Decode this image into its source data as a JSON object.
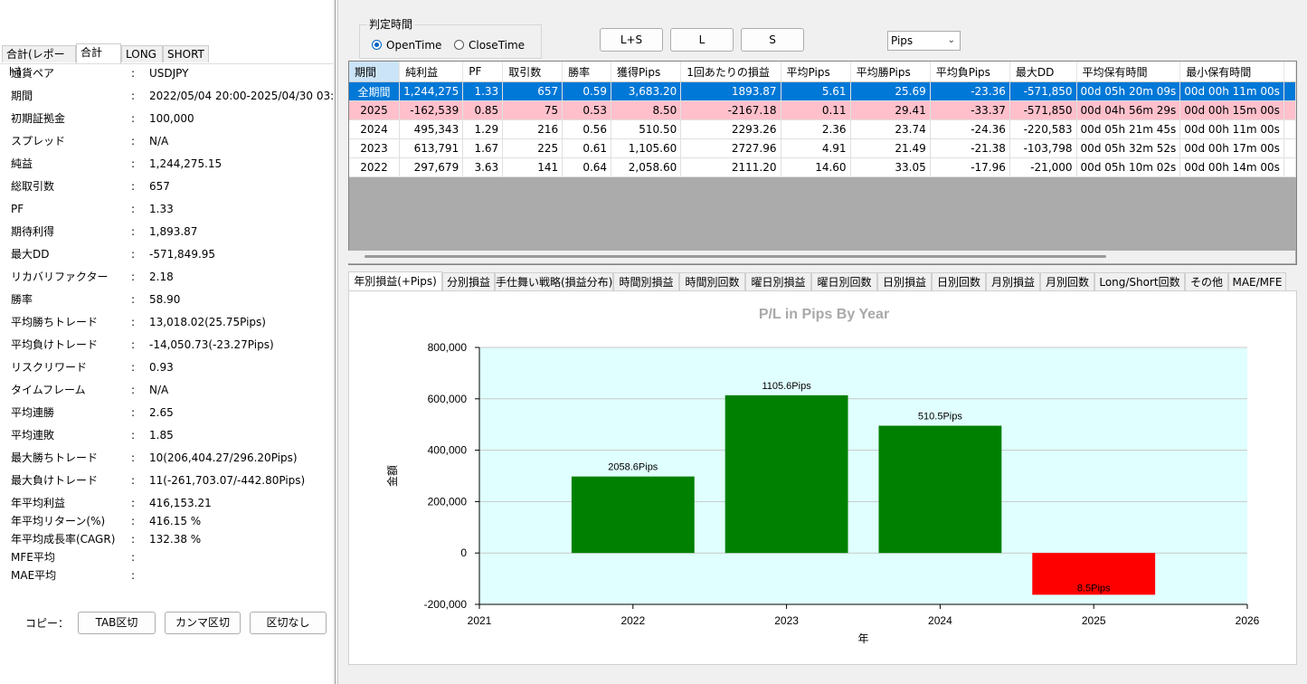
{
  "left": {
    "tabs": [
      "合計(レポート)",
      "合計",
      "LONG",
      "SHORT"
    ],
    "active_tab": "合計",
    "stats": [
      {
        "label": "通貨ペア",
        "value": "USDJPY"
      },
      {
        "label": "期間",
        "value": "2022/05/04 20:00-2025/04/30 03:"
      },
      {
        "label": "初期証拠金",
        "value": "100,000"
      },
      {
        "label": "スプレッド",
        "value": "N/A"
      },
      {
        "label": "純益",
        "value": "1,244,275.15"
      },
      {
        "label": "総取引数",
        "value": "657"
      },
      {
        "label": "PF",
        "value": "1.33"
      },
      {
        "label": "期待利得",
        "value": "1,893.87"
      },
      {
        "label": "最大DD",
        "value": "-571,849.95"
      },
      {
        "label": "リカバリファクター",
        "value": "2.18"
      },
      {
        "label": "勝率",
        "value": "58.90"
      },
      {
        "label": "平均勝ちトレード",
        "value": "13,018.02(25.75Pips)"
      },
      {
        "label": "平均負けトレード",
        "value": "-14,050.73(-23.27Pips)"
      },
      {
        "label": "リスクリワード",
        "value": "0.93"
      },
      {
        "label": "タイムフレーム",
        "value": "N/A"
      },
      {
        "label": "平均連勝",
        "value": "2.65"
      },
      {
        "label": "平均連敗",
        "value": "1.85"
      },
      {
        "label": "最大勝ちトレード",
        "value": "10(206,404.27/296.20Pips)"
      },
      {
        "label": "最大負けトレード",
        "value": "11(-261,703.07/-442.80Pips)"
      },
      {
        "label": "年平均利益",
        "value": "416,153.21"
      },
      {
        "label": "年平均リターン(%)",
        "value": "416.15 %"
      },
      {
        "label": "年平均成長率(CAGR)",
        "value": "132.38 %"
      },
      {
        "label": "MFE平均",
        "value": ""
      },
      {
        "label": "MAE平均",
        "value": ""
      }
    ],
    "colon": ":",
    "copy_label": "コピー：",
    "copy_buttons": [
      "TAB区切",
      "カンマ区切",
      "区切なし"
    ]
  },
  "controls": {
    "group_title": "判定時間",
    "radio_open": "OpenTime",
    "radio_close": "CloseTime",
    "selected_radio": "OpenTime",
    "btn_ls": "L+S",
    "btn_l": "L",
    "btn_s": "S",
    "unit_select": "Pips"
  },
  "table": {
    "columns": [
      "期間",
      "純利益",
      "PF",
      "取引数",
      "勝率",
      "獲得Pips",
      "1回あたりの損益",
      "平均Pips",
      "平均勝Pips",
      "平均負Pips",
      "最大DD",
      "平均保有時間",
      "最小保有時間"
    ],
    "rows": [
      [
        "全期間",
        "1,244,275",
        "1.33",
        "657",
        "0.59",
        "3,683.20",
        "1893.87",
        "5.61",
        "25.69",
        "-23.36",
        "-571,850",
        "00d 05h 20m 09s",
        "00d 00h 11m 00s"
      ],
      [
        "2025",
        "-162,539",
        "0.85",
        "75",
        "0.53",
        "8.50",
        "-2167.18",
        "0.11",
        "29.41",
        "-33.37",
        "-571,850",
        "00d 04h 56m 29s",
        "00d 00h 15m 00s"
      ],
      [
        "2024",
        "495,343",
        "1.29",
        "216",
        "0.56",
        "510.50",
        "2293.26",
        "2.36",
        "23.74",
        "-24.36",
        "-220,583",
        "00d 05h 21m 45s",
        "00d 00h 11m 00s"
      ],
      [
        "2023",
        "613,791",
        "1.67",
        "225",
        "0.61",
        "1,105.60",
        "2727.96",
        "4.91",
        "21.49",
        "-21.38",
        "-103,798",
        "00d 05h 32m 52s",
        "00d 00h 17m 00s"
      ],
      [
        "2022",
        "297,679",
        "3.63",
        "141",
        "0.64",
        "2,058.60",
        "2111.20",
        "14.60",
        "33.05",
        "-17.96",
        "-21,000",
        "00d 05h 10m 02s",
        "00d 00h 14m 00s"
      ]
    ],
    "selected_row": 0,
    "highlight_row": 1
  },
  "bottom_tabs": [
    "年別損益(+Pips)",
    "分別損益",
    "手仕舞い戦略(損益分布)",
    "時間別損益",
    "時間別回数",
    "曜日別損益",
    "曜日別回数",
    "日別損益",
    "日別回数",
    "月別損益",
    "月別回数",
    "Long/Short回数",
    "その他",
    "MAE/MFE"
  ],
  "active_bottom_tab": "年別損益(+Pips)",
  "chart_data": {
    "type": "bar",
    "title": "P/L in Pips By Year",
    "xlabel": "年",
    "ylabel": "金額",
    "x_ticks": [
      "2021",
      "2022",
      "2023",
      "2024",
      "2025",
      "2026"
    ],
    "y_ticks": [
      "800,000",
      "600,000",
      "400,000",
      "200,000",
      "0",
      "-200,000"
    ],
    "xlim": [
      2021,
      2026
    ],
    "ylim": [
      -200000,
      800000
    ],
    "bars": [
      {
        "year": 2022,
        "value": 297679,
        "label": "2058.6Pips",
        "color": "#008000"
      },
      {
        "year": 2023,
        "value": 613791,
        "label": "1105.6Pips",
        "color": "#008000"
      },
      {
        "year": 2024,
        "value": 495343,
        "label": "510.5Pips",
        "color": "#008000"
      },
      {
        "year": 2025,
        "value": -162539,
        "label": "8.5Pips",
        "color": "#ff0000"
      }
    ],
    "plot_background": "#e0ffff",
    "grid": true
  }
}
